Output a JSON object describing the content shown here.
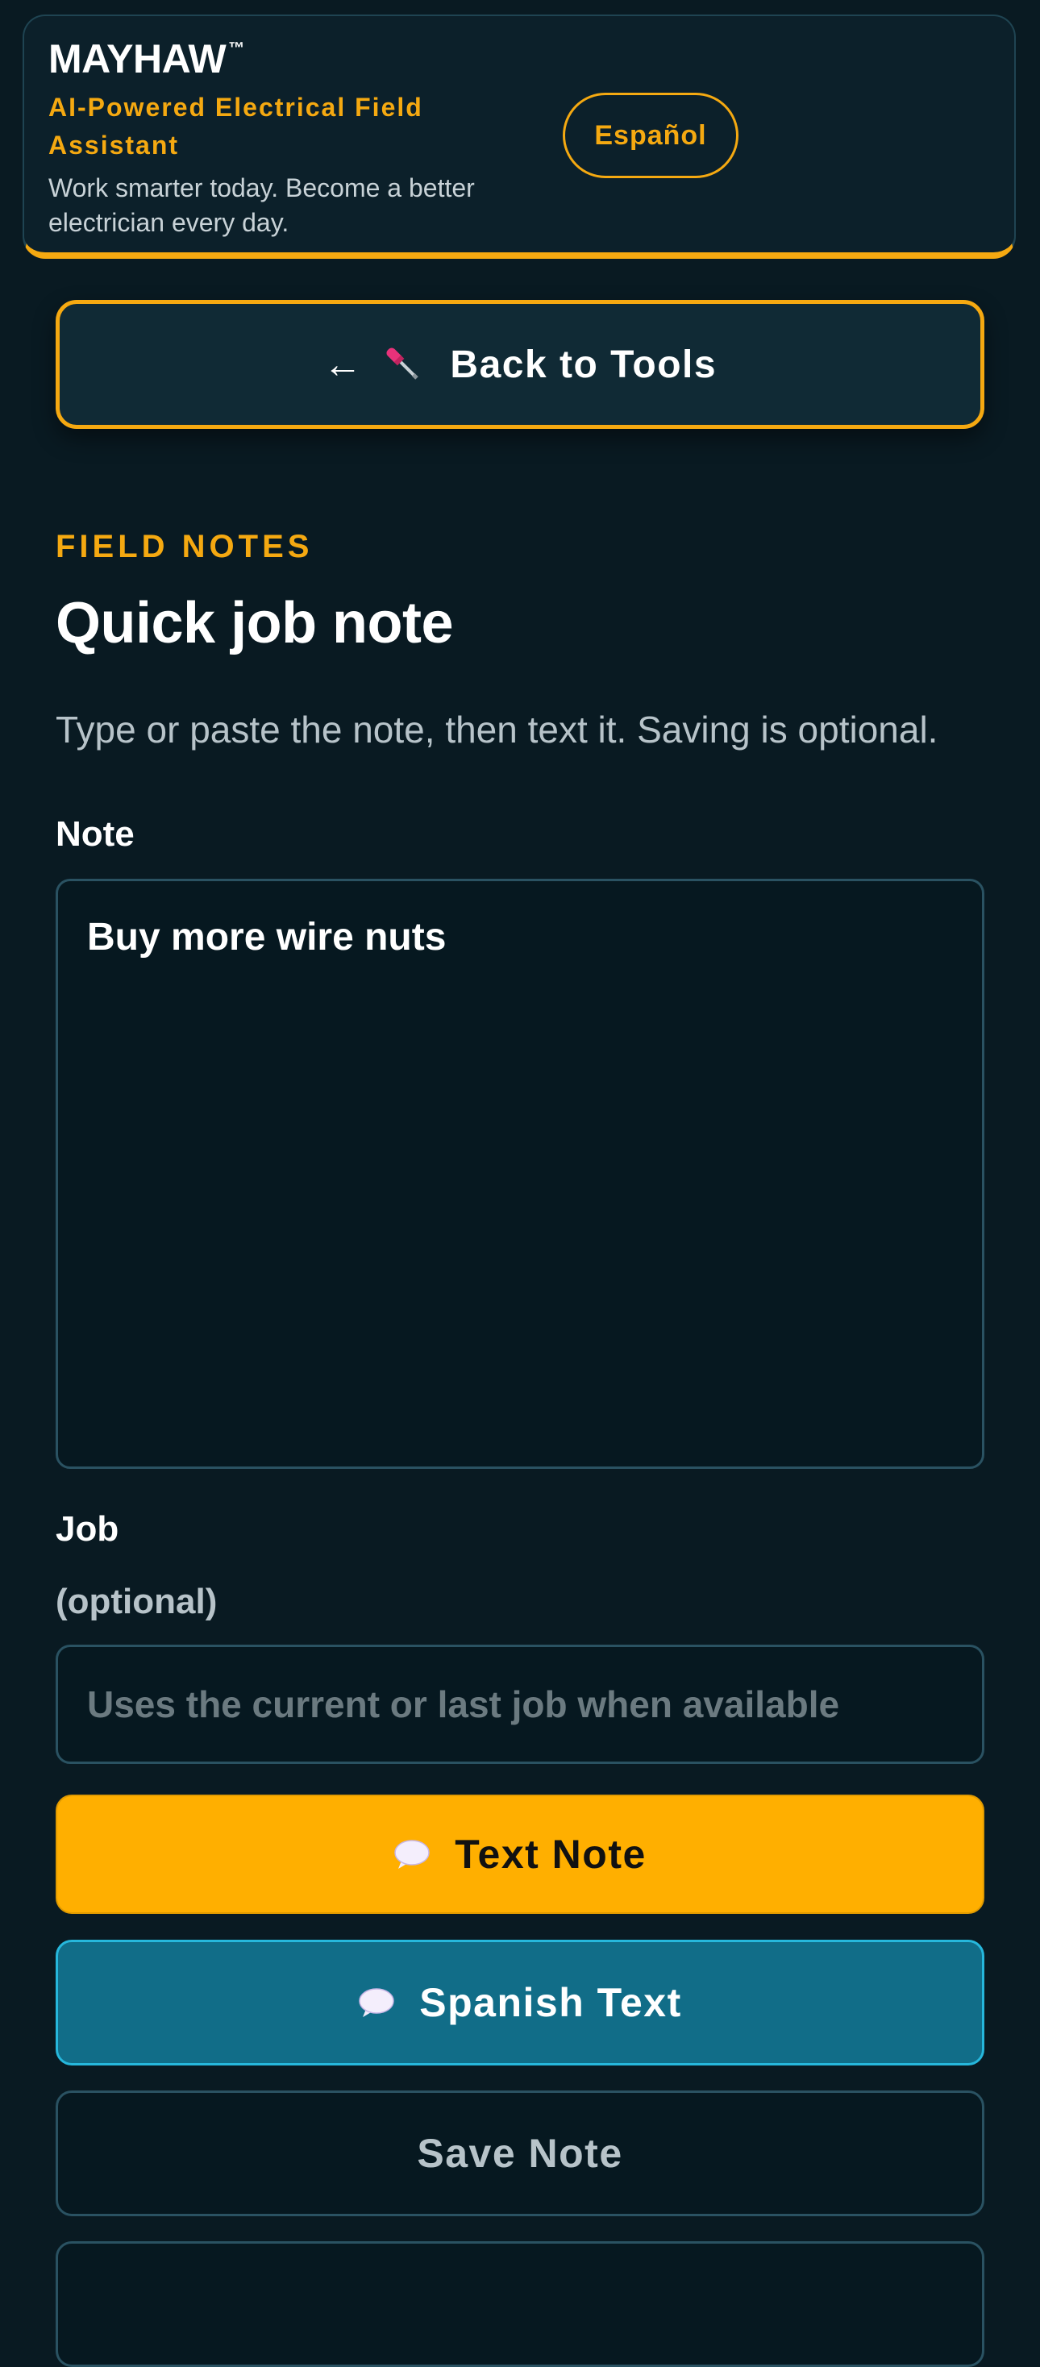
{
  "header": {
    "brand": "MAYHAW",
    "trademark": "™",
    "tagline": "AI-Powered Electrical Field Assistant",
    "subline": "Work smarter today. Become a better electrician every day.",
    "language_button": "Español"
  },
  "nav": {
    "back_arrow": "←",
    "back_label": "Back to Tools",
    "back_icon": "screwdriver-icon"
  },
  "section": {
    "eyebrow": "FIELD NOTES",
    "title": "Quick job note",
    "intro": "Type or paste the note, then text it. Saving is optional."
  },
  "form": {
    "note_label": "Note",
    "note_value": "Buy more wire nuts",
    "job_label": "Job",
    "job_optional": "(optional)",
    "job_placeholder": "Uses the current or last job when available"
  },
  "actions": {
    "text_note": "Text Note",
    "spanish_text": "Spanish Text",
    "save_note": "Save Note",
    "message_icon": "speech-bubble-icon"
  },
  "colors": {
    "background": "#091a22",
    "accent": "#f5a911",
    "primary_button": "#ffaf00",
    "secondary_button": "#116d88"
  }
}
